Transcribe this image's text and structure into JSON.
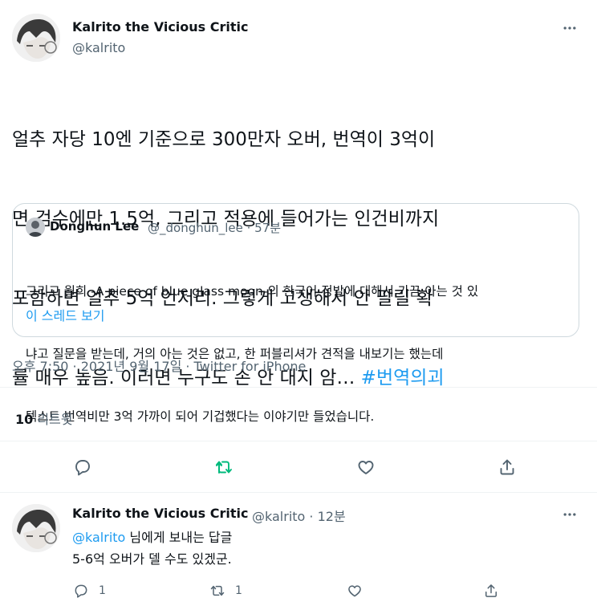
{
  "main_tweet": {
    "author_name": "Kalrito the Vicious Critic",
    "author_handle": "@kalrito",
    "text_lines": [
      "얼추 자당 10엔 기준으로 300만자 오버, 번역이 3억이",
      "면 검수에만 1.5억, 그리고 적용에 들어가는 인건비까지",
      "포함하면 얼추 5억 언저리. 그렇게 고생해서 안 팔릴 확"
    ],
    "text_last": "률 매우 높음. 이러면 누구도 손 안 대지 암… ",
    "hashtag": "#번역의괴",
    "timestamp": "오후 7:50 · 2021년 9월 17일 · Twitter for iPhone",
    "retweet_count": "10",
    "retweet_label": "리트윗"
  },
  "quote": {
    "author_name": "Donghun Lee",
    "author_meta": "@_donghun_lee · 57분",
    "text_lines": [
      "그리고 월희 -A piece of blue glass moon-의 한국어 정발에 대해서 가끔 아는 것 있",
      "냐고 질문을 받는데, 거의 아는 것은 없고, 한 퍼블리셔가 견적을 내보기는 했는데",
      "텍스트 번역비만 3억 가까이 되어 기겁했다는 이야기만 들었습니다."
    ],
    "thread_link": "이 스레드 보기"
  },
  "reply": {
    "author_name": "Kalrito the Vicious Critic",
    "author_meta": "@kalrito · 12분",
    "mention": "@kalrito",
    "replying_to_suffix": " 님에게 보내는 답글",
    "text": "5-6억 오버가 델 수도 있겠군.",
    "reply_count": "1",
    "retweet_count": "1"
  },
  "icons": {
    "reply": "reply-icon",
    "retweet": "retweet-icon",
    "like": "heart-icon",
    "share": "share-icon",
    "more": "more-dots-icon"
  },
  "colors": {
    "accent": "#1d9bf0",
    "retweet_active": "#00ba7c",
    "secondary_text": "#536471",
    "border": "#cfd9de"
  }
}
